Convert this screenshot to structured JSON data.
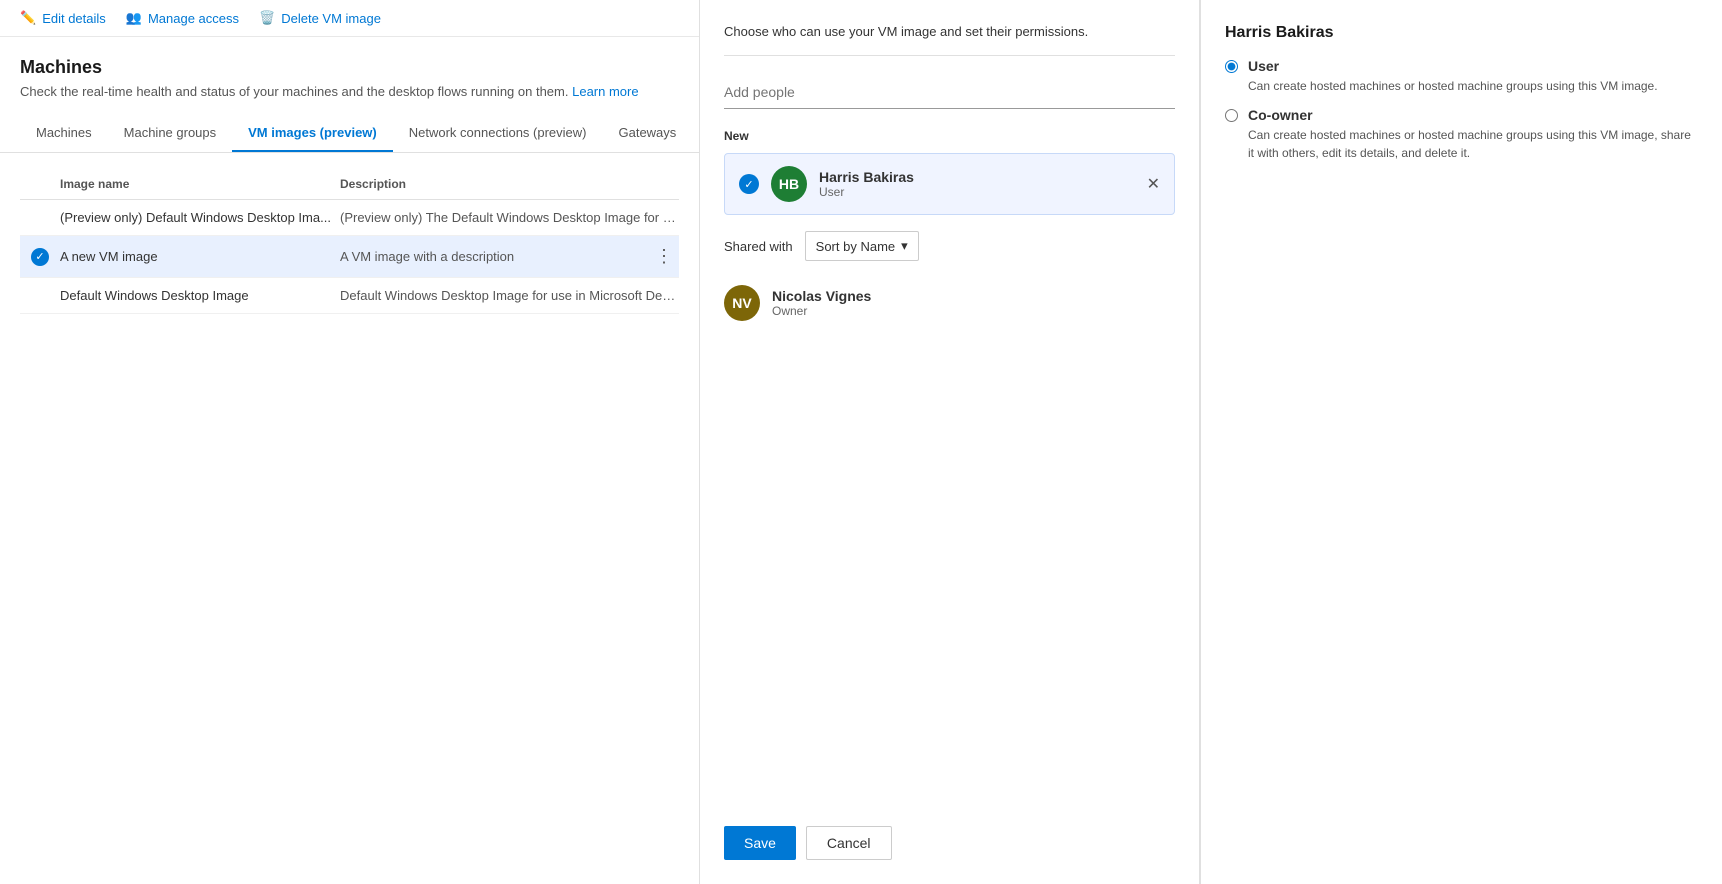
{
  "toolbar": {
    "edit_label": "Edit details",
    "manage_label": "Manage access",
    "delete_label": "Delete VM image"
  },
  "left": {
    "title": "Machines",
    "description": "Check the real-time health and status of your machines and the desktop flows running on them.",
    "learn_more": "Learn more",
    "tabs": [
      {
        "label": "Machines",
        "active": false
      },
      {
        "label": "Machine groups",
        "active": false
      },
      {
        "label": "VM images (preview)",
        "active": true
      },
      {
        "label": "Network connections (preview)",
        "active": false
      },
      {
        "label": "Gateways",
        "active": false
      }
    ],
    "columns": {
      "name": "Image name",
      "description": "Description"
    },
    "rows": [
      {
        "name": "(Preview only) Default Windows Desktop Ima...",
        "description": "(Preview only) The Default Windows Desktop Image for use i...",
        "selected": false
      },
      {
        "name": "A new VM image",
        "description": "A VM image with a description",
        "selected": true
      },
      {
        "name": "Default Windows Desktop Image",
        "description": "Default Windows Desktop Image for use in Microsoft Deskto...",
        "selected": false
      }
    ]
  },
  "manage": {
    "panel_desc": "Choose who can use your VM image and set their permissions.",
    "add_people_placeholder": "Add people",
    "new_label": "New",
    "new_person": {
      "name": "Harris Bakiras",
      "role": "User",
      "avatar_bg": "#1e7e34",
      "initials": "HB"
    },
    "shared_with_label": "Shared with",
    "sort_label": "Sort by Name",
    "shared_people": [
      {
        "name": "Nicolas Vignes",
        "role": "Owner",
        "avatar_bg": "#7d6608",
        "initials": "NV"
      }
    ],
    "save_label": "Save",
    "cancel_label": "Cancel"
  },
  "details": {
    "person_name": "Harris Bakiras",
    "options": [
      {
        "id": "user",
        "label": "User",
        "description": "Can create hosted machines or hosted machine groups using this VM image.",
        "selected": true
      },
      {
        "id": "coowner",
        "label": "Co-owner",
        "description": "Can create hosted machines or hosted machine groups using this VM image, share it with others, edit its details, and delete it.",
        "selected": false
      }
    ]
  }
}
